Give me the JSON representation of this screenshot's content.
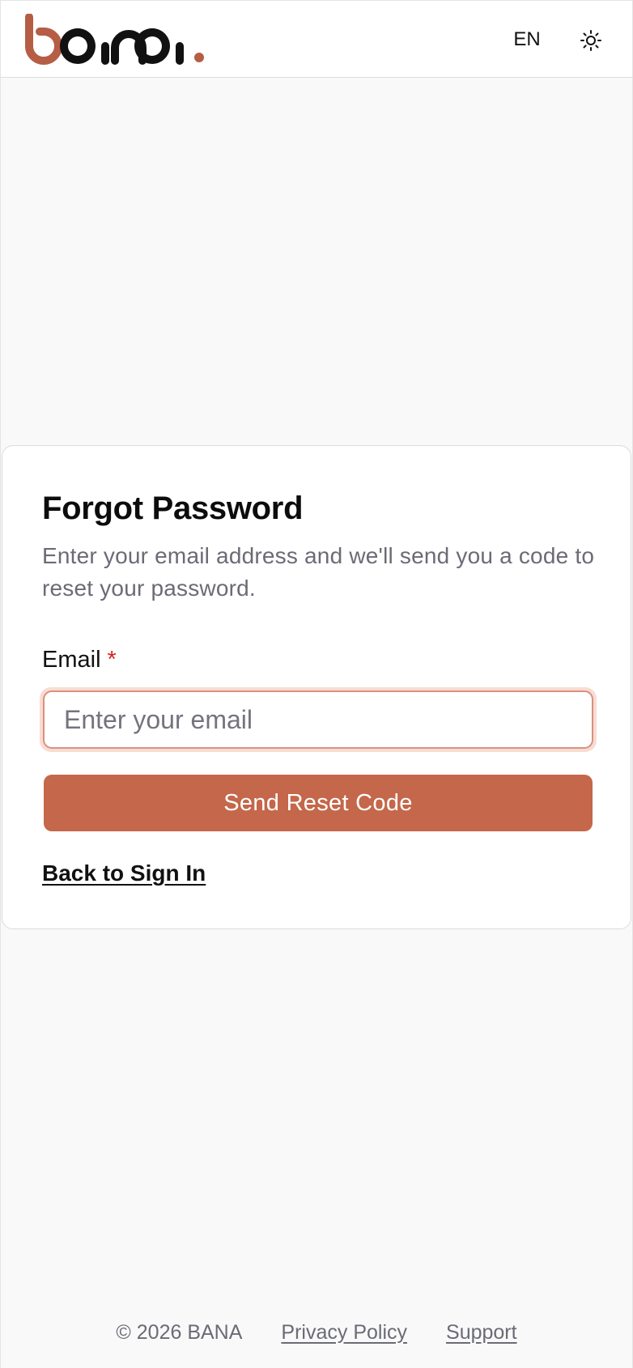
{
  "header": {
    "logo_text": "bana.",
    "language_label": "EN",
    "theme_icon": "sun-icon"
  },
  "card": {
    "title": "Forgot Password",
    "description": "Enter your email address and we'll send you a code to reset your password.",
    "email_label": "Email",
    "required_marker": "*",
    "email_placeholder": "Enter your email",
    "email_value": "",
    "submit_label": "Send Reset Code",
    "back_link_label": "Back to Sign In"
  },
  "footer": {
    "copyright": "© 2026 BANA",
    "privacy_label": "Privacy Policy",
    "support_label": "Support"
  },
  "colors": {
    "brand": "#c4674a",
    "logo_dark": "#111111",
    "background": "#f9f9f9",
    "required": "#d32626",
    "muted_text": "#6b6b76"
  }
}
